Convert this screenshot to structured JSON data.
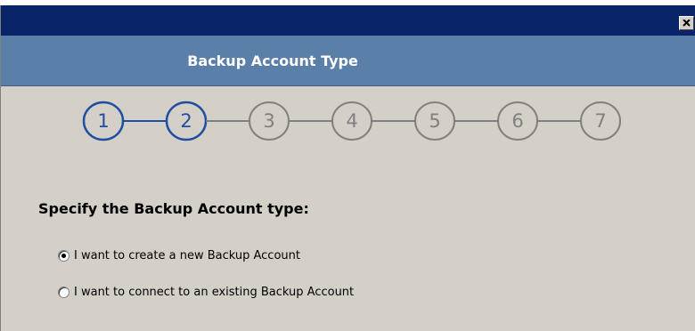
{
  "window": {
    "close_glyph": "close-icon"
  },
  "header": {
    "title": "Backup Account Type"
  },
  "steps": {
    "items": [
      "1",
      "2",
      "3",
      "4",
      "5",
      "6",
      "7"
    ],
    "active_count": 2,
    "active_color": "#1f4fa3",
    "inactive_color": "#808080"
  },
  "content": {
    "heading": "Specify the Backup Account type:",
    "options": [
      {
        "label": "I want to create a new Backup Account",
        "selected": true
      },
      {
        "label": "I want to connect to an existing Backup Account",
        "selected": false
      }
    ]
  },
  "colors": {
    "title_bar": "#0a246a",
    "header_band": "#5a7fa9",
    "dialog_background": "#d4d0c8"
  }
}
